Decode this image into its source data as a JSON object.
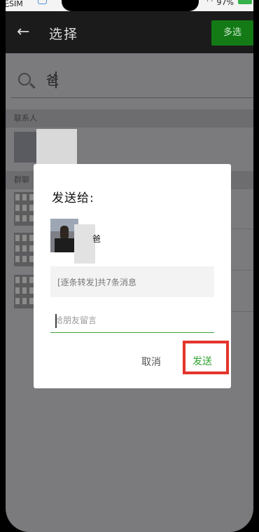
{
  "status": {
    "carrier": "无SIM",
    "battery": "97%"
  },
  "header": {
    "title": "选择",
    "multi_select": "多选"
  },
  "search": {
    "query": "爸"
  },
  "sections": {
    "contacts": "联系人",
    "groups": "群聊"
  },
  "dialog": {
    "title": "发送给:",
    "recipient_name": "爸",
    "message_preview": "[逐条转发]共7条消息",
    "comment_placeholder": "给朋友留言",
    "cancel_label": "取消",
    "send_label": "发送"
  },
  "colors": {
    "accent_green": "#137a16",
    "send_text": "#2fa52f",
    "highlight_red": "#e3342b"
  }
}
